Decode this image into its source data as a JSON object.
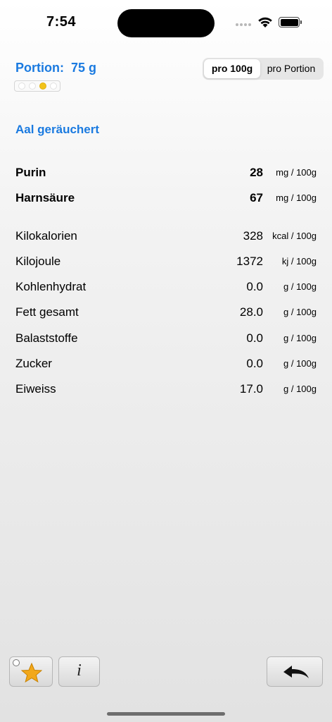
{
  "status_bar": {
    "time": "7:54"
  },
  "portion": {
    "label": "Portion:",
    "value": "75 g",
    "level_indicator": {
      "total": 4,
      "active_index": 2
    }
  },
  "toggle": {
    "options": [
      "pro 100g",
      "pro Portion"
    ],
    "selected": "pro 100g"
  },
  "food": {
    "name": "Aal geräuchert"
  },
  "primary_rows": [
    {
      "name": "Purin",
      "value": "28",
      "unit": "mg / 100g"
    },
    {
      "name": "Harnsäure",
      "value": "67",
      "unit": "mg / 100g"
    }
  ],
  "nutrient_rows": [
    {
      "name": "Kilokalorien",
      "value": "328",
      "unit": "kcal / 100g"
    },
    {
      "name": "Kilojoule",
      "value": "1372",
      "unit": "kj / 100g"
    },
    {
      "name": "Kohlenhydrat",
      "value": "0.0",
      "unit": "g / 100g"
    },
    {
      "name": "Fett gesamt",
      "value": "28.0",
      "unit": "g / 100g"
    },
    {
      "name": "Balaststoffe",
      "value": "0.0",
      "unit": "g / 100g"
    },
    {
      "name": "Zucker",
      "value": "0.0",
      "unit": "g / 100g"
    },
    {
      "name": "Eiweiss",
      "value": "17.0",
      "unit": "g / 100g"
    }
  ],
  "toolbar": {
    "favorite_icon": "star-icon",
    "info_glyph": "i",
    "back_icon": "back-arrow-icon"
  },
  "colors": {
    "accent": "#1a7ae0",
    "star": "#f2a81a",
    "active_dot": "#f2c31a"
  }
}
